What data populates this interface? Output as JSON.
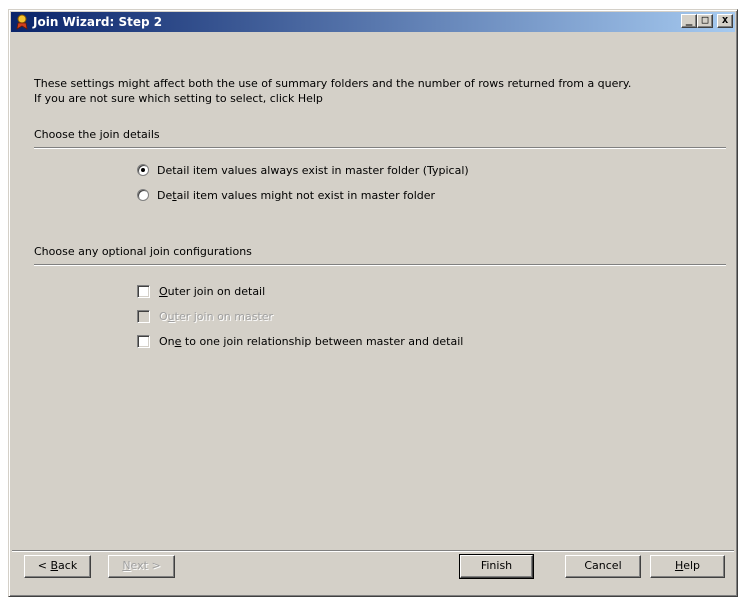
{
  "window": {
    "title": "Join Wizard: Step 2",
    "title_icon": "wizard-icon",
    "controls": {
      "minimize": "_",
      "maximize": "□",
      "close": "x"
    }
  },
  "intro": {
    "line1": "These settings might affect both the use of summary folders and the number of rows returned from a query.",
    "line2": "If you are not sure which setting to select, click Help"
  },
  "join_details": {
    "heading": "Choose the join details",
    "options": [
      {
        "pre": "Detail item values always exist in master folder (Typical)",
        "mn": "",
        "post": "",
        "checked": true
      },
      {
        "pre": "De",
        "mn": "t",
        "post": "ail item values might not exist in master folder",
        "checked": false
      }
    ]
  },
  "join_config": {
    "heading": "Choose any optional join configurations",
    "options": [
      {
        "pre": "",
        "mn": "O",
        "post": "uter join on detail",
        "checked": false,
        "enabled": true
      },
      {
        "pre": "O",
        "mn": "u",
        "post": "ter join on master",
        "checked": false,
        "enabled": false
      },
      {
        "pre": "On",
        "mn": "e",
        "post": " to one join relationship between master and detail",
        "checked": false,
        "enabled": true
      }
    ]
  },
  "buttons": {
    "back": {
      "prefix": "< ",
      "mn": "B",
      "post": "ack"
    },
    "next": {
      "prefix": "",
      "mn": "N",
      "post": "ext >"
    },
    "finish": "Finish",
    "cancel": "Cancel",
    "help": {
      "mn": "H",
      "post": "elp"
    }
  },
  "colors": {
    "dialog_bg": "#d4d0c8",
    "title_gradient_start": "#0a246a",
    "title_gradient_end": "#a6caf0",
    "disabled_text": "#a0a0a0"
  }
}
